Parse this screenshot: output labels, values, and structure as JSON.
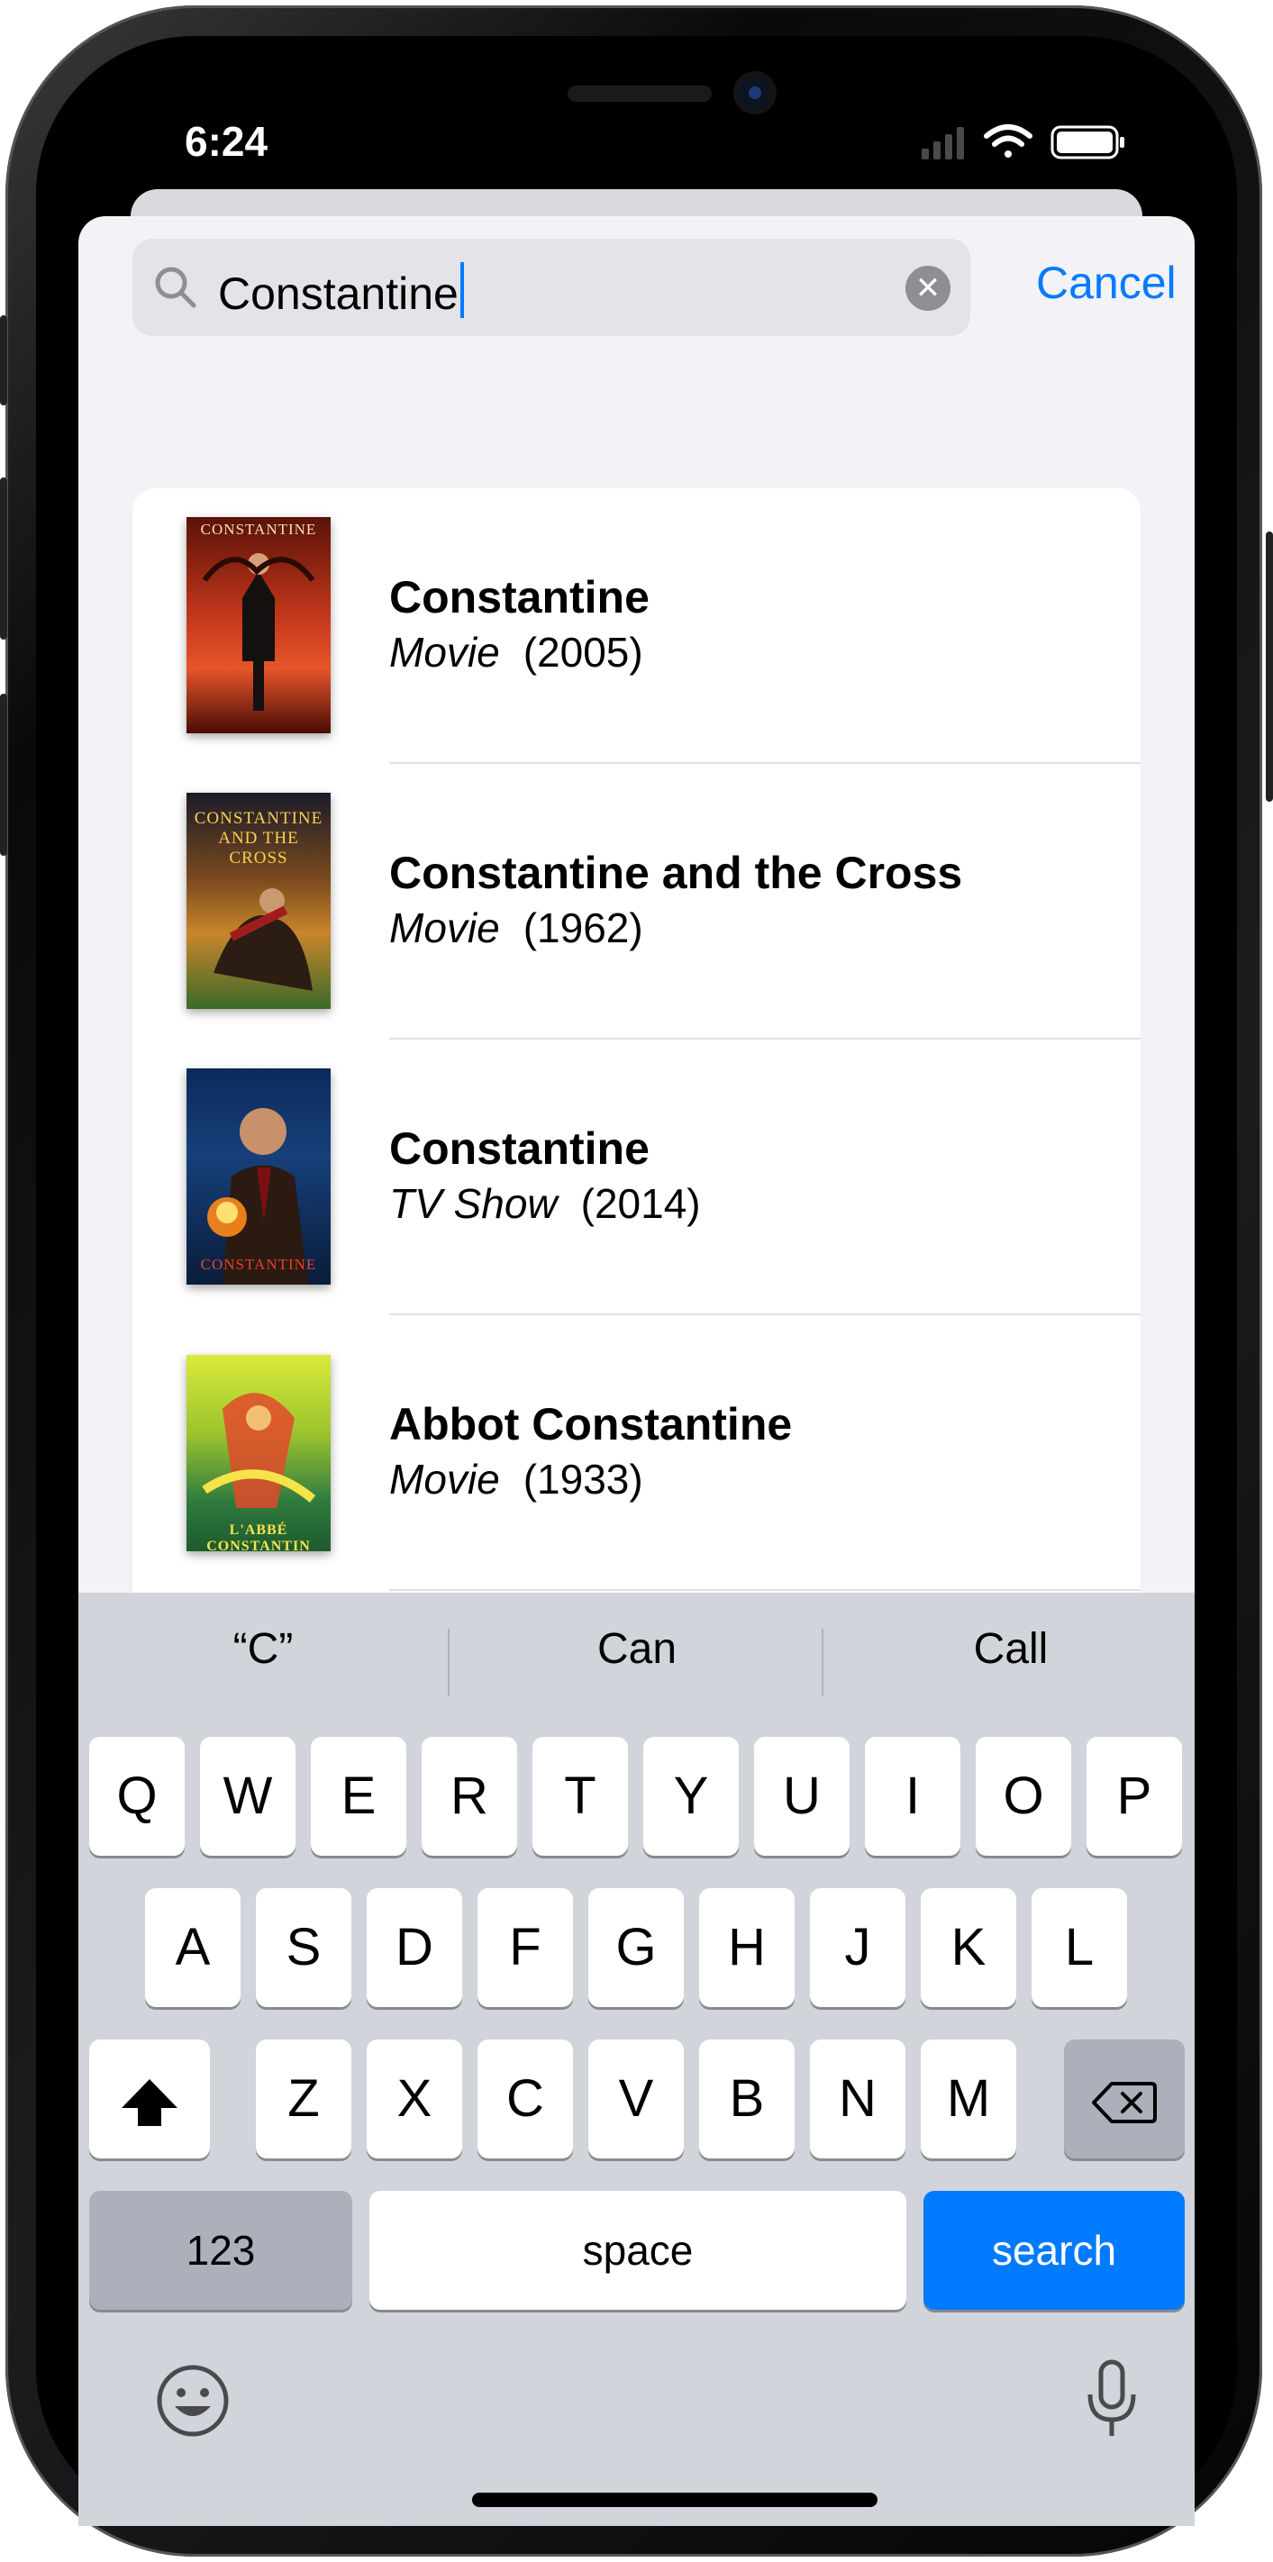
{
  "status_bar": {
    "time": "6:24"
  },
  "search": {
    "query": "Constantine",
    "cancel_label": "Cancel"
  },
  "results": [
    {
      "title": "Constantine",
      "kind": "Movie",
      "year": "(2005)",
      "poster_text": "CONSTANTINE"
    },
    {
      "title": "Constantine and the Cross",
      "kind": "Movie",
      "year": "(1962)",
      "poster_text": "CONSTANTINE AND THE CROSS"
    },
    {
      "title": "Constantine",
      "kind": "TV Show",
      "year": "(2014)",
      "poster_text": "CONSTANTINE"
    },
    {
      "title": "Abbot Constantine",
      "kind": "Movie",
      "year": "(1933)",
      "poster_text": "L'ABBÉ CONSTANTIN"
    }
  ],
  "keyboard": {
    "suggestions": [
      "“C”",
      "Can",
      "Call"
    ],
    "row1": [
      "Q",
      "W",
      "E",
      "R",
      "T",
      "Y",
      "U",
      "I",
      "O",
      "P"
    ],
    "row2": [
      "A",
      "S",
      "D",
      "F",
      "G",
      "H",
      "J",
      "K",
      "L"
    ],
    "row3": [
      "Z",
      "X",
      "C",
      "V",
      "B",
      "N",
      "M"
    ],
    "numbers_label": "123",
    "space_label": "space",
    "search_label": "search"
  },
  "colors": {
    "accent": "#007aff",
    "sheet_bg": "#f2f2f7",
    "keyboard_bg": "#d1d4db"
  }
}
